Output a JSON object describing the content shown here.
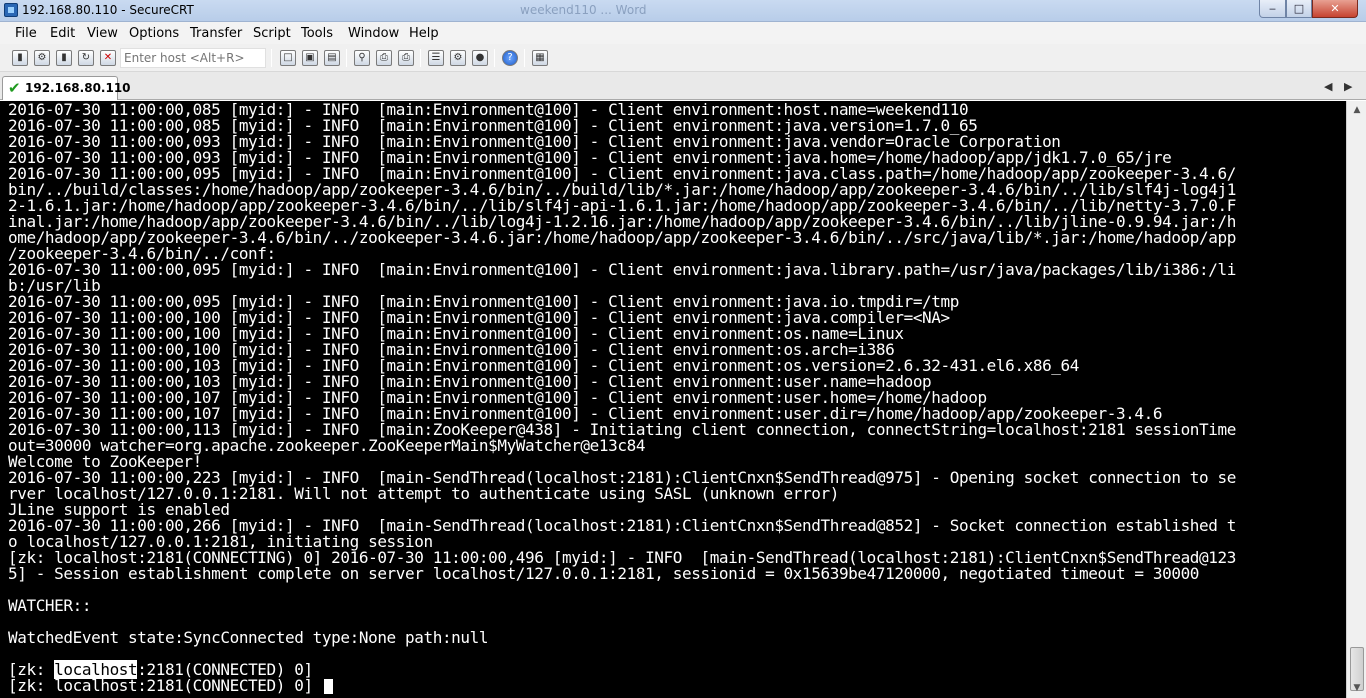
{
  "window": {
    "title": "192.168.80.110 - SecureCRT",
    "background_title": "weekend110 ... Word",
    "minimize": "‒",
    "maximize": "□",
    "close": "✕"
  },
  "menu": [
    "File",
    "Edit",
    "View",
    "Options",
    "Transfer",
    "Script",
    "Tools",
    "Window",
    "Help"
  ],
  "toolbar": {
    "host_placeholder": "Enter host <Alt+R>",
    "icons": [
      "connect-icon",
      "quick-connect-icon",
      "connect-tab-icon",
      "reconnect-icon",
      "disconnect-icon",
      "copy-icon",
      "paste-icon",
      "copy-paste-icon",
      "find-icon",
      "print-icon",
      "print-selection-icon",
      "print-setup-icon",
      "session-options-icon",
      "global-options-icon",
      "keymap-icon",
      "help-icon",
      "extra-icon"
    ]
  },
  "tab": {
    "label": "192.168.80.110",
    "status_icon": "check-icon",
    "nav_left": "◀",
    "nav_right": "▶"
  },
  "terminal": {
    "lines": [
      "2016-07-30 11:00:00,085 [myid:] - INFO  [main:Environment@100] - Client environment:host.name=weekend110",
      "2016-07-30 11:00:00,085 [myid:] - INFO  [main:Environment@100] - Client environment:java.version=1.7.0_65",
      "2016-07-30 11:00:00,093 [myid:] - INFO  [main:Environment@100] - Client environment:java.vendor=Oracle Corporation",
      "2016-07-30 11:00:00,093 [myid:] - INFO  [main:Environment@100] - Client environment:java.home=/home/hadoop/app/jdk1.7.0_65/jre",
      "2016-07-30 11:00:00,095 [myid:] - INFO  [main:Environment@100] - Client environment:java.class.path=/home/hadoop/app/zookeeper-3.4.6/",
      "bin/../build/classes:/home/hadoop/app/zookeeper-3.4.6/bin/../build/lib/*.jar:/home/hadoop/app/zookeeper-3.4.6/bin/../lib/slf4j-log4j1",
      "2-1.6.1.jar:/home/hadoop/app/zookeeper-3.4.6/bin/../lib/slf4j-api-1.6.1.jar:/home/hadoop/app/zookeeper-3.4.6/bin/../lib/netty-3.7.0.F",
      "inal.jar:/home/hadoop/app/zookeeper-3.4.6/bin/../lib/log4j-1.2.16.jar:/home/hadoop/app/zookeeper-3.4.6/bin/../lib/jline-0.9.94.jar:/h",
      "ome/hadoop/app/zookeeper-3.4.6/bin/../zookeeper-3.4.6.jar:/home/hadoop/app/zookeeper-3.4.6/bin/../src/java/lib/*.jar:/home/hadoop/app",
      "/zookeeper-3.4.6/bin/../conf:",
      "2016-07-30 11:00:00,095 [myid:] - INFO  [main:Environment@100] - Client environment:java.library.path=/usr/java/packages/lib/i386:/li",
      "b:/usr/lib",
      "2016-07-30 11:00:00,095 [myid:] - INFO  [main:Environment@100] - Client environment:java.io.tmpdir=/tmp",
      "2016-07-30 11:00:00,100 [myid:] - INFO  [main:Environment@100] - Client environment:java.compiler=<NA>",
      "2016-07-30 11:00:00,100 [myid:] - INFO  [main:Environment@100] - Client environment:os.name=Linux",
      "2016-07-30 11:00:00,100 [myid:] - INFO  [main:Environment@100] - Client environment:os.arch=i386",
      "2016-07-30 11:00:00,103 [myid:] - INFO  [main:Environment@100] - Client environment:os.version=2.6.32-431.el6.x86_64",
      "2016-07-30 11:00:00,103 [myid:] - INFO  [main:Environment@100] - Client environment:user.name=hadoop",
      "2016-07-30 11:00:00,107 [myid:] - INFO  [main:Environment@100] - Client environment:user.home=/home/hadoop",
      "2016-07-30 11:00:00,107 [myid:] - INFO  [main:Environment@100] - Client environment:user.dir=/home/hadoop/app/zookeeper-3.4.6",
      "2016-07-30 11:00:00,113 [myid:] - INFO  [main:ZooKeeper@438] - Initiating client connection, connectString=localhost:2181 sessionTime",
      "out=30000 watcher=org.apache.zookeeper.ZooKeeperMain$MyWatcher@e13c84",
      "Welcome to ZooKeeper!",
      "2016-07-30 11:00:00,223 [myid:] - INFO  [main-SendThread(localhost:2181):ClientCnxn$SendThread@975] - Opening socket connection to se",
      "rver localhost/127.0.0.1:2181. Will not attempt to authenticate using SASL (unknown error)",
      "JLine support is enabled",
      "2016-07-30 11:00:00,266 [myid:] - INFO  [main-SendThread(localhost:2181):ClientCnxn$SendThread@852] - Socket connection established t",
      "o localhost/127.0.0.1:2181, initiating session",
      "[zk: localhost:2181(CONNECTING) 0] 2016-07-30 11:00:00,496 [myid:] - INFO  [main-SendThread(localhost:2181):ClientCnxn$SendThread@123",
      "5] - Session establishment complete on server localhost/127.0.0.1:2181, sessionid = 0x15639be47120000, negotiated timeout = 30000",
      "",
      "WATCHER::",
      "",
      "WatchedEvent state:SyncConnected type:None path:null",
      ""
    ],
    "prompt1": {
      "pre": "[zk: ",
      "highlight": "localhost",
      "post": ":2181(CONNECTED) 0]"
    },
    "prompt2": "[zk: localhost:2181(CONNECTED) 0] "
  },
  "scrollbar": {
    "up": "▲",
    "down": "▼",
    "position": 0.98
  }
}
